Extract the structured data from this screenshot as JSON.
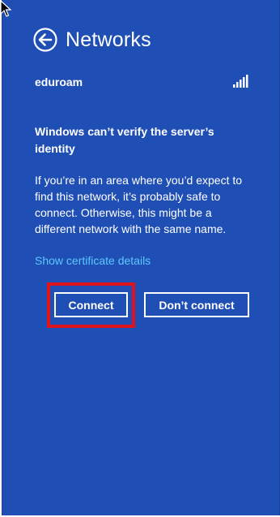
{
  "header": {
    "title": "Networks",
    "back_icon": "back-arrow-circle-icon"
  },
  "network": {
    "name": "eduroam",
    "signal_icon": "wifi-signal-full-icon",
    "signal_bars": 5
  },
  "dialog": {
    "heading": "Windows can’t verify the server’s identity",
    "body": "If you’re in an area where you’d expect to find this network, it’s probably safe to connect. Otherwise, this might be a different network with the same name.",
    "cert_link": "Show certificate details",
    "connect_label": "Connect",
    "dont_connect_label": "Don’t connect"
  },
  "colors": {
    "panel_background": "#1f4fb5",
    "link": "#5ec7ff",
    "highlight": "#e0121c"
  }
}
